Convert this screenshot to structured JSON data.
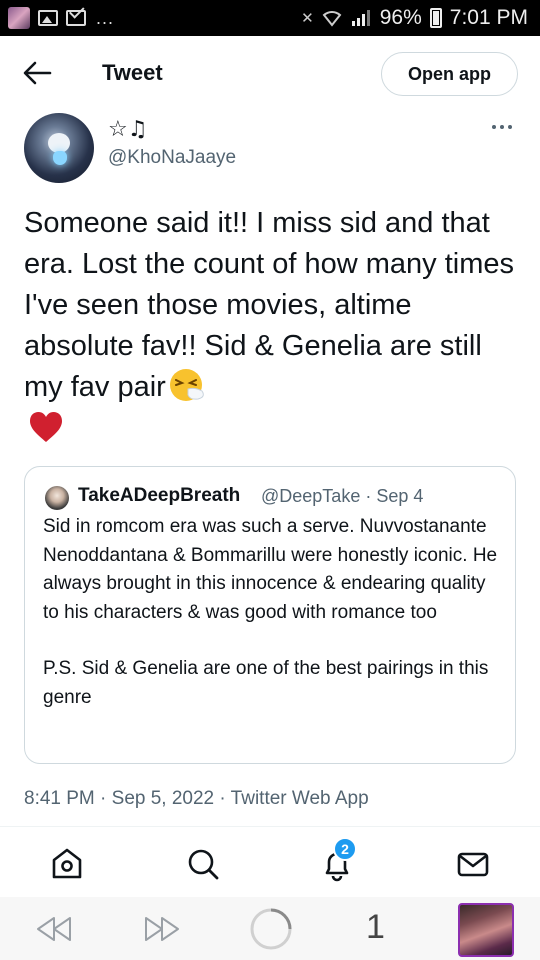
{
  "status_bar": {
    "dots": "...",
    "battery": "96%",
    "time": "7:01 PM"
  },
  "header": {
    "title": "Tweet",
    "open_app_label": "Open app"
  },
  "author": {
    "display_name": "☆♫",
    "handle": "@KhoNaJaaye"
  },
  "tweet": {
    "text": "Someone said it!! I miss sid and that era. Lost the count of how many times I've seen those movies, altime absolute fav!! Sid & Genelia are still my fav pair"
  },
  "quoted_tweet": {
    "name": "TakeADeepBreath",
    "meta": "@DeepTake · Sep 4",
    "paragraph_1": "Sid in romcom era was such a serve. Nuvvostanante Nenoddantana & Bommarillu were honestly iconic. He always brought in this innocence & endearing quality to his characters & was good with romance too",
    "paragraph_2": "P.S. Sid & Genelia are one of the best pairings in this genre"
  },
  "timestamp": {
    "time_date": "8:41 PM · Sep 5, 2022",
    "separator": " · ",
    "source": "Twitter Web App"
  },
  "nav": {
    "notifications_badge": "2"
  },
  "browser": {
    "tab_count": "1"
  },
  "icons": {
    "back": "arrow-left-icon",
    "more": "more-horizontal-icon",
    "home": "home-icon",
    "search": "search-icon",
    "notifications": "bell-icon",
    "messages": "mail-icon"
  },
  "colors": {
    "accent": "#1d9bf0",
    "text": "#0f1419",
    "secondary": "#536471",
    "border": "#cfd9de",
    "heart": "#d0202f"
  }
}
